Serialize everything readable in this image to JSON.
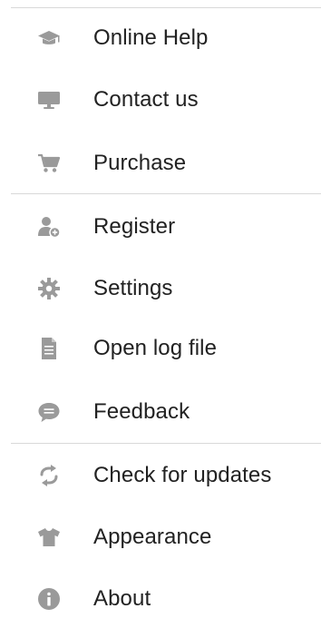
{
  "menu": {
    "sections": [
      {
        "items": [
          {
            "label": "Online Help",
            "icon": "graduation-cap-icon"
          },
          {
            "label": "Contact us",
            "icon": "monitor-icon"
          },
          {
            "label": "Purchase",
            "icon": "shopping-cart-icon"
          }
        ]
      },
      {
        "items": [
          {
            "label": "Register",
            "icon": "user-add-icon"
          },
          {
            "label": "Settings",
            "icon": "gear-icon"
          },
          {
            "label": "Open log file",
            "icon": "document-icon"
          },
          {
            "label": "Feedback",
            "icon": "speech-bubble-icon"
          }
        ]
      },
      {
        "items": [
          {
            "label": "Check for updates",
            "icon": "refresh-icon"
          },
          {
            "label": "Appearance",
            "icon": "tshirt-icon"
          },
          {
            "label": "About",
            "icon": "info-icon"
          }
        ]
      }
    ],
    "icon_color": "#9a9a9a",
    "text_color": "#222222",
    "divider_color": "#d9d9d9"
  }
}
